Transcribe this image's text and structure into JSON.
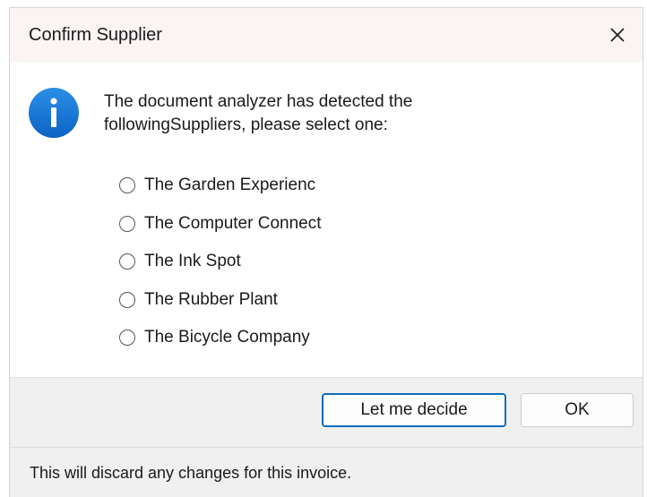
{
  "window": {
    "title": "Confirm Supplier",
    "close_icon": "close-icon"
  },
  "message": {
    "icon": "info-icon",
    "line1": "The document analyzer has detected the",
    "line2": "followingSuppliers, please select one:"
  },
  "suppliers": [
    {
      "label": "The Garden Experienc",
      "selected": false
    },
    {
      "label": "The Computer Connect",
      "selected": false
    },
    {
      "label": "The Ink Spot",
      "selected": false
    },
    {
      "label": "The Rubber Plant",
      "selected": false
    },
    {
      "label": "The Bicycle Company",
      "selected": false
    }
  ],
  "buttons": {
    "decide_label": "Let me decide",
    "ok_label": "OK"
  },
  "footer": {
    "text": "This will discard any changes for this invoice."
  },
  "colors": {
    "accent": "#0f6cbd",
    "info_icon": "#1479d4",
    "titlebar_bg": "#faf4f3",
    "button_bar_bg": "#f0f0f0"
  }
}
